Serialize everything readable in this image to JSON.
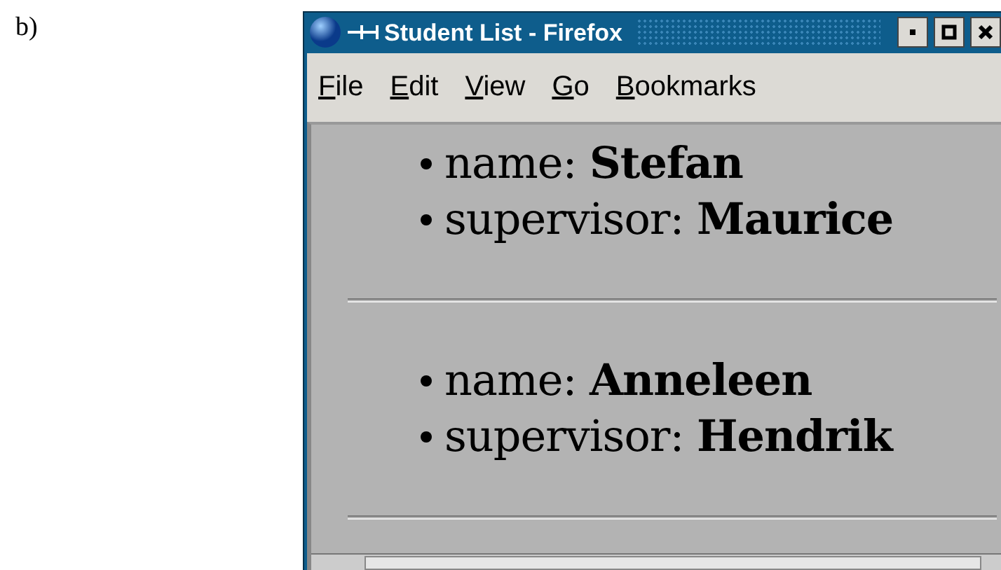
{
  "figure_label": "b)",
  "window": {
    "title": "Student List - Firefox"
  },
  "menu": [
    {
      "label": "File"
    },
    {
      "label": "Edit"
    },
    {
      "label": "View"
    },
    {
      "label": "Go"
    },
    {
      "label": "Bookmarks"
    }
  ],
  "students": [
    {
      "fields": [
        {
          "label": "name: ",
          "value": "Stefan"
        },
        {
          "label": "supervisor: ",
          "value": "Maurice"
        }
      ]
    },
    {
      "fields": [
        {
          "label": "name: ",
          "value": "Anneleen"
        },
        {
          "label": "supervisor: ",
          "value": "Hendrik"
        }
      ]
    }
  ]
}
